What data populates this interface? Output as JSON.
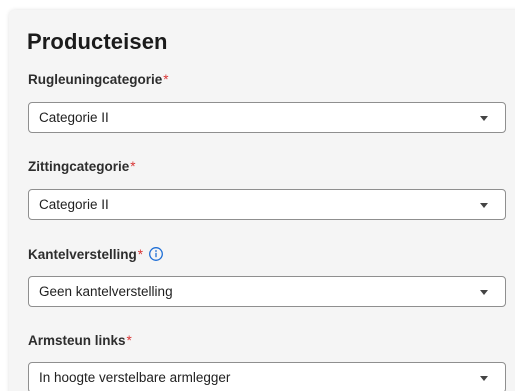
{
  "section": {
    "title": "Producteisen"
  },
  "fields": [
    {
      "label": "Rugleuningcategorie",
      "required_marker": "*",
      "value": "Categorie II"
    },
    {
      "label": "Zittingcategorie",
      "required_marker": "*",
      "value": "Categorie II"
    },
    {
      "label": "Kantelverstelling",
      "required_marker": "*",
      "value": "Geen kantelverstelling",
      "info_icon": "info-circle-icon"
    },
    {
      "label": "Armsteun links",
      "required_marker": "*",
      "value": "In hoogte verstelbare armlegger"
    }
  ],
  "colors": {
    "required": "#d93535",
    "info_icon": "#1f6fd6",
    "panel_background": "#f5f5f5",
    "select_border": "#8f8f8f"
  }
}
